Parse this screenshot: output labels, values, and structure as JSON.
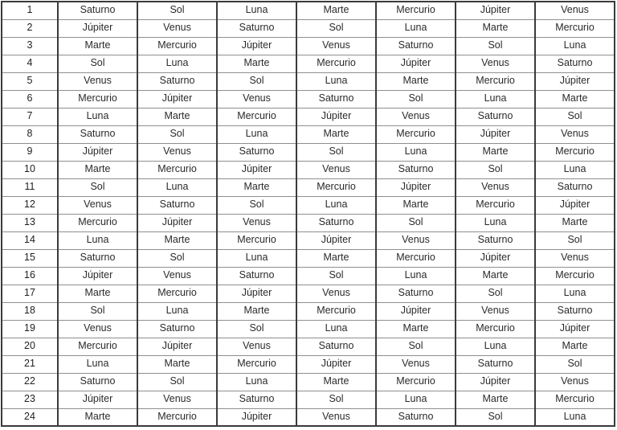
{
  "table": {
    "name": "planetary-hours-table",
    "row_count": 24,
    "column_count": 8,
    "index_column_label": "",
    "day_column_labels": [
      "",
      "",
      "",
      "",
      "",
      "",
      ""
    ],
    "planet_names": [
      "Sol",
      "Luna",
      "Marte",
      "Mercurio",
      "Júpiter",
      "Venus",
      "Saturno"
    ],
    "border_color_vertical": "#3b3b3b",
    "border_color_horizontal": "#8f8f8f",
    "text_color": "#2b2b2b",
    "background_color": "#ffffff",
    "rows": [
      {
        "index": "1",
        "cells": [
          "Saturno",
          "Sol",
          "Luna",
          "Marte",
          "Mercurio",
          "Júpiter",
          "Venus"
        ]
      },
      {
        "index": "2",
        "cells": [
          "Júpiter",
          "Venus",
          "Saturno",
          "Sol",
          "Luna",
          "Marte",
          "Mercurio"
        ]
      },
      {
        "index": "3",
        "cells": [
          "Marte",
          "Mercurio",
          "Júpiter",
          "Venus",
          "Saturno",
          "Sol",
          "Luna"
        ]
      },
      {
        "index": "4",
        "cells": [
          "Sol",
          "Luna",
          "Marte",
          "Mercurio",
          "Júpiter",
          "Venus",
          "Saturno"
        ]
      },
      {
        "index": "5",
        "cells": [
          "Venus",
          "Saturno",
          "Sol",
          "Luna",
          "Marte",
          "Mercurio",
          "Júpiter"
        ]
      },
      {
        "index": "6",
        "cells": [
          "Mercurio",
          "Júpiter",
          "Venus",
          "Saturno",
          "Sol",
          "Luna",
          "Marte"
        ]
      },
      {
        "index": "7",
        "cells": [
          "Luna",
          "Marte",
          "Mercurio",
          "Júpiter",
          "Venus",
          "Saturno",
          "Sol"
        ]
      },
      {
        "index": "8",
        "cells": [
          "Saturno",
          "Sol",
          "Luna",
          "Marte",
          "Mercurio",
          "Júpiter",
          "Venus"
        ]
      },
      {
        "index": "9",
        "cells": [
          "Júpiter",
          "Venus",
          "Saturno",
          "Sol",
          "Luna",
          "Marte",
          "Mercurio"
        ]
      },
      {
        "index": "10",
        "cells": [
          "Marte",
          "Mercurio",
          "Júpiter",
          "Venus",
          "Saturno",
          "Sol",
          "Luna"
        ]
      },
      {
        "index": "11",
        "cells": [
          "Sol",
          "Luna",
          "Marte",
          "Mercurio",
          "Júpiter",
          "Venus",
          "Saturno"
        ]
      },
      {
        "index": "12",
        "cells": [
          "Venus",
          "Saturno",
          "Sol",
          "Luna",
          "Marte",
          "Mercurio",
          "Júpiter"
        ]
      },
      {
        "index": "13",
        "cells": [
          "Mercurio",
          "Júpiter",
          "Venus",
          "Saturno",
          "Sol",
          "Luna",
          "Marte"
        ]
      },
      {
        "index": "14",
        "cells": [
          "Luna",
          "Marte",
          "Mercurio",
          "Júpiter",
          "Venus",
          "Saturno",
          "Sol"
        ]
      },
      {
        "index": "15",
        "cells": [
          "Saturno",
          "Sol",
          "Luna",
          "Marte",
          "Mercurio",
          "Júpiter",
          "Venus"
        ]
      },
      {
        "index": "16",
        "cells": [
          "Júpiter",
          "Venus",
          "Saturno",
          "Sol",
          "Luna",
          "Marte",
          "Mercurio"
        ]
      },
      {
        "index": "17",
        "cells": [
          "Marte",
          "Mercurio",
          "Júpiter",
          "Venus",
          "Saturno",
          "Sol",
          "Luna"
        ]
      },
      {
        "index": "18",
        "cells": [
          "Sol",
          "Luna",
          "Marte",
          "Mercurio",
          "Júpiter",
          "Venus",
          "Saturno"
        ]
      },
      {
        "index": "19",
        "cells": [
          "Venus",
          "Saturno",
          "Sol",
          "Luna",
          "Marte",
          "Mercurio",
          "Júpiter"
        ]
      },
      {
        "index": "20",
        "cells": [
          "Mercurio",
          "Júpiter",
          "Venus",
          "Saturno",
          "Sol",
          "Luna",
          "Marte"
        ]
      },
      {
        "index": "21",
        "cells": [
          "Luna",
          "Marte",
          "Mercurio",
          "Júpiter",
          "Venus",
          "Saturno",
          "Sol"
        ]
      },
      {
        "index": "22",
        "cells": [
          "Saturno",
          "Sol",
          "Luna",
          "Marte",
          "Mercurio",
          "Júpiter",
          "Venus"
        ]
      },
      {
        "index": "23",
        "cells": [
          "Júpiter",
          "Venus",
          "Saturno",
          "Sol",
          "Luna",
          "Marte",
          "Mercurio"
        ]
      },
      {
        "index": "24",
        "cells": [
          "Marte",
          "Mercurio",
          "Júpiter",
          "Venus",
          "Saturno",
          "Sol",
          "Luna"
        ]
      }
    ]
  }
}
